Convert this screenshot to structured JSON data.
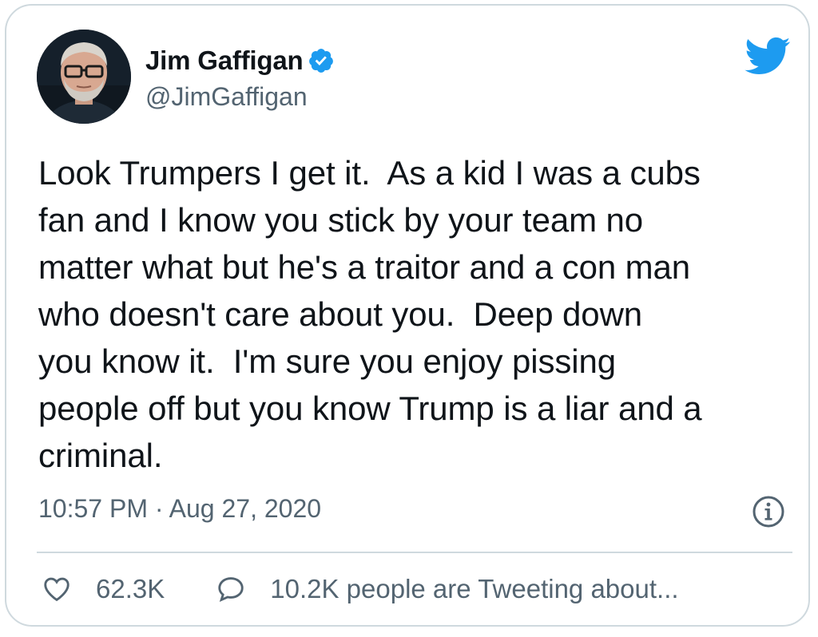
{
  "user": {
    "display_name": "Jim Gaffigan",
    "handle": "@JimGaffigan",
    "verified": true
  },
  "tweet": {
    "text": "Look Trumpers I get it.  As a kid I was a cubs\nfan and I know you stick by your team no\nmatter what but he's a traitor and a con man\nwho doesn't care about you.  Deep down\nyou know it.  I'm sure you enjoy pissing\npeople off but you know Trump is a liar and a\ncriminal.",
    "timestamp": "10:57 PM · Aug 27, 2020"
  },
  "actions": {
    "likes": "62.3K",
    "replies_text": "10.2K people are Tweeting about..."
  },
  "icons": {
    "logo": "twitter-bird-icon",
    "verified": "verified-badge-icon",
    "info": "info-icon",
    "like": "heart-icon",
    "reply": "speech-bubble-icon"
  },
  "colors": {
    "brand_blue": "#1d9bf0",
    "text_primary": "#0f1419",
    "text_secondary": "#536471",
    "border": "#cfd9de"
  }
}
